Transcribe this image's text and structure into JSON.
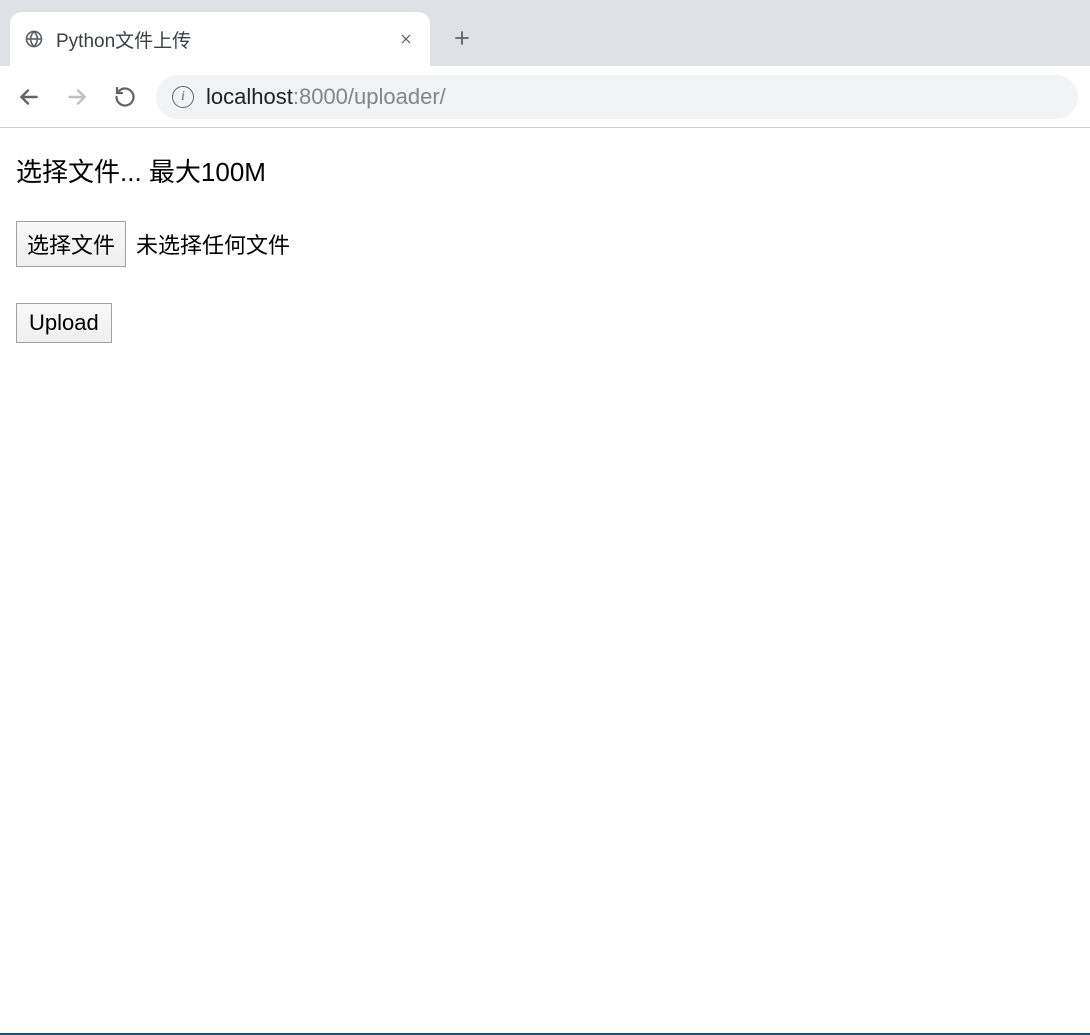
{
  "browser": {
    "tab_title": "Python文件上传",
    "url_host": "localhost",
    "url_port": ":8000",
    "url_path": "/uploader/"
  },
  "page": {
    "heading": "选择文件... 最大100M",
    "choose_file_label": "选择文件",
    "no_file_chosen": "未选择任何文件",
    "upload_button": "Upload"
  }
}
